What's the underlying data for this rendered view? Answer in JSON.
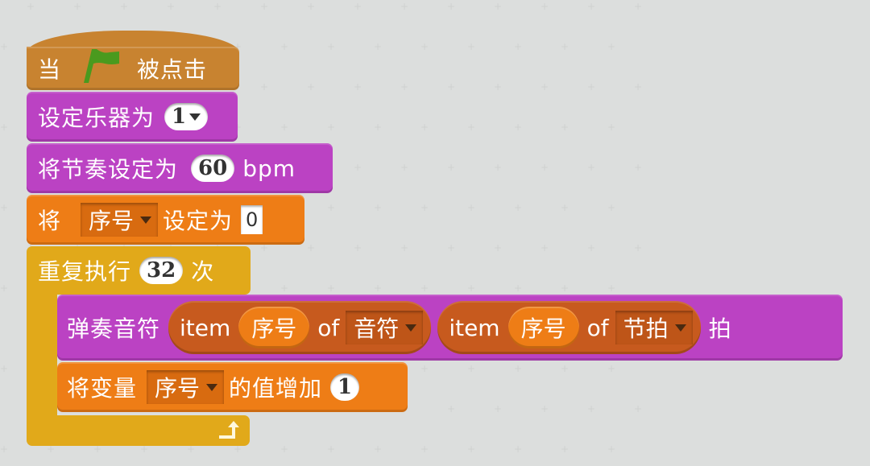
{
  "workspace": {
    "background": "#dcdedd"
  },
  "colors": {
    "events": "#c88330",
    "sound": "#bb42c3",
    "variables": "#ee7d16",
    "control": "#e1a91a",
    "list": "#c75a1e",
    "flag": "#4a9a1e"
  },
  "script": {
    "hat": {
      "prefix": "当",
      "icon": "green-flag-icon",
      "suffix": "被点击"
    },
    "set_instrument": {
      "label": "设定乐器为",
      "value": "1"
    },
    "set_tempo": {
      "label": "将节奏设定为",
      "value": "60",
      "unit": "bpm"
    },
    "set_var": {
      "prefix": "将",
      "variable": "序号",
      "middle": "设定为",
      "value": "0"
    },
    "repeat": {
      "label": "重复执行",
      "count": "32",
      "suffix": "次",
      "loop_icon": "loop-arrow-icon"
    },
    "play_note": {
      "label": "弹奏音符",
      "note": {
        "item_label": "item",
        "index_var": "序号",
        "of_label": "of",
        "list": "音符"
      },
      "beats": {
        "item_label": "item",
        "index_var": "序号",
        "of_label": "of",
        "list": "节拍"
      },
      "suffix": "拍"
    },
    "change_var": {
      "prefix": "将变量",
      "variable": "序号",
      "middle": "的值增加",
      "value": "1"
    }
  }
}
